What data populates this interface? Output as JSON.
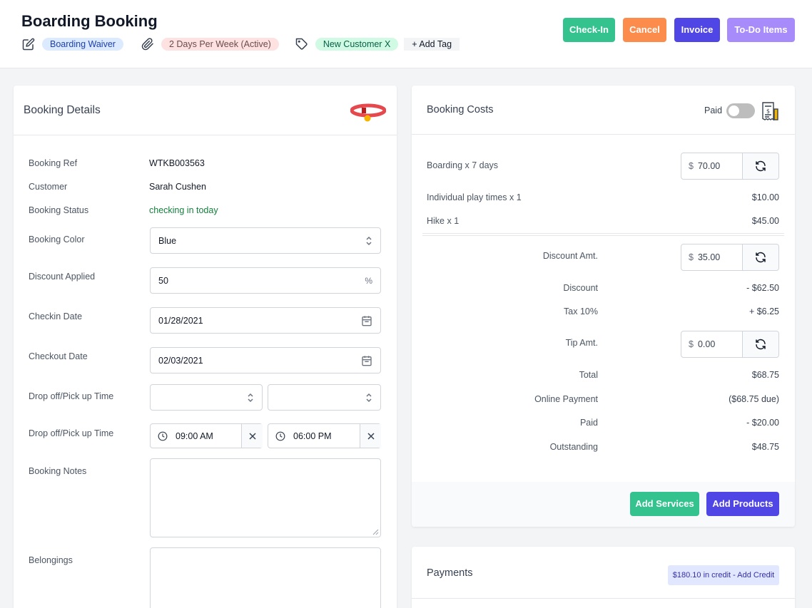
{
  "header": {
    "title": "Boarding Booking",
    "tags": {
      "waiver": "Boarding Waiver",
      "plan": "2 Days Per Week (Active)",
      "customer_tag": "New Customer X",
      "add_tag": "+ Add Tag"
    },
    "buttons": {
      "checkin": "Check-In",
      "cancel": "Cancel",
      "invoice": "Invoice",
      "todo": "To-Do Items"
    }
  },
  "details": {
    "title": "Booking Details",
    "booking_ref_label": "Booking Ref",
    "booking_ref": "WTKB003563",
    "customer_label": "Customer",
    "customer": "Sarah Cushen",
    "status_label": "Booking Status",
    "status": "checking in today",
    "color_label": "Booking Color",
    "color_value": "Blue",
    "discount_label": "Discount Applied",
    "discount_value": "50",
    "discount_unit": "%",
    "checkin_label": "Checkin Date",
    "checkin_value": "01/28/2021",
    "checkout_label": "Checkout Date",
    "checkout_value": "02/03/2021",
    "dropoff_label_1": "Drop off/Pick up Time",
    "dropoff_label_2": "Drop off/Pick up Time",
    "dropoff_time": "09:00 AM",
    "pickup_time": "06:00 PM",
    "notes_label": "Booking Notes",
    "belongings_label": "Belongings"
  },
  "costs": {
    "title": "Booking Costs",
    "paid_label": "Paid",
    "boarding_label": "Boarding  x 7 days",
    "boarding_currency": "$",
    "boarding_amount": "70.00",
    "play_label": "Individual play times  x 1",
    "play_amount": "$10.00",
    "hike_label": "Hike  x 1",
    "hike_amount": "$45.00",
    "discount_amt_label": "Discount Amt.",
    "discount_amt_currency": "$",
    "discount_amt_value": "35.00",
    "discount_label": "Discount",
    "discount_value": "- $62.50",
    "tax_label": "Tax 10%",
    "tax_value": "+ $6.25",
    "tip_label": "Tip Amt.",
    "tip_currency": "$",
    "tip_value": "0.00",
    "total_label": "Total",
    "total_value": "$68.75",
    "online_label": "Online Payment",
    "online_value": "($68.75 due)",
    "paid_row_label": "Paid",
    "paid_row_value": "- $20.00",
    "outstanding_label": "Outstanding",
    "outstanding_value": "$48.75",
    "add_services": "Add Services",
    "add_products": "Add Products"
  },
  "payments": {
    "title": "Payments",
    "credit": "$180.10 in credit - Add Credit"
  },
  "colors": {
    "green": "#34c38f",
    "orange": "#fb8c4c",
    "indigo": "#5046e5",
    "lavender": "#a78bfa"
  }
}
